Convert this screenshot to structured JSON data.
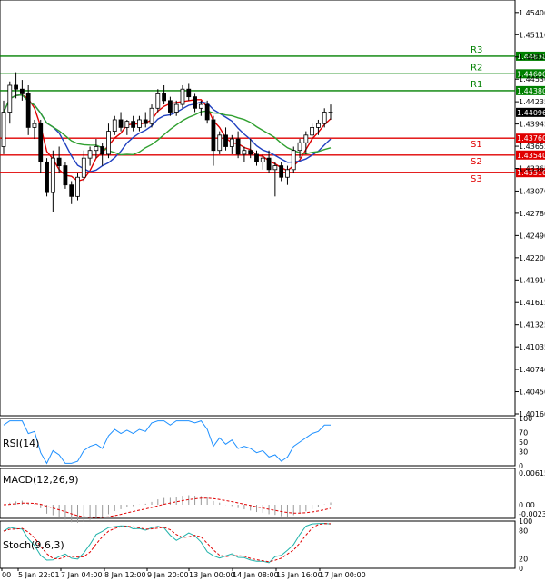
{
  "chart_data": [
    {
      "type": "candlestick",
      "panel": "price",
      "ylim": [
        1.4016,
        1.4554
      ],
      "y_ticks": [
        "1.45400",
        "1.45110",
        "1.44820",
        "1.44530",
        "1.44235",
        "1.43945",
        "1.43655",
        "1.43365",
        "1.43070",
        "1.42780",
        "1.42490",
        "1.42200",
        "1.41910",
        "1.41615",
        "1.41325",
        "1.41035",
        "1.40740",
        "1.40450",
        "1.40160"
      ],
      "x_labels": [
        "00",
        "5 Jan 22:01",
        "7 Jan 04:00",
        "8 Jan 12:00",
        "9 Jan 20:00",
        "13 Jan 00:00",
        "14 Jan 08:00",
        "15 Jan 16:00",
        "17 Jan 00:00"
      ],
      "levels": [
        {
          "name": "R3",
          "value": 1.4483,
          "label": "1.44830",
          "color": "#008000"
        },
        {
          "name": "R2",
          "value": 1.446,
          "label": "1.44600",
          "color": "#008000"
        },
        {
          "name": "R1",
          "value": 1.4438,
          "label": "1.44380",
          "color": "#008000"
        },
        {
          "name": "S1",
          "value": 1.4376,
          "label": "1.43760",
          "color": "#e00000"
        },
        {
          "name": "S2",
          "value": 1.4354,
          "label": "1.43540",
          "color": "#e00000"
        },
        {
          "name": "S3",
          "value": 1.4331,
          "label": "1.43310",
          "color": "#e00000"
        }
      ],
      "current_price": {
        "value": 1.44096,
        "label": "1.44096"
      },
      "candles": [
        [
          1.4365,
          1.4425,
          1.4355,
          1.441
        ],
        [
          1.441,
          1.445,
          1.4395,
          1.4445
        ],
        [
          1.4445,
          1.4462,
          1.4428,
          1.444
        ],
        [
          1.444,
          1.4452,
          1.4425,
          1.4435
        ],
        [
          1.4435,
          1.4445,
          1.438,
          1.439
        ],
        [
          1.439,
          1.44,
          1.4375,
          1.4395
        ],
        [
          1.4395,
          1.44,
          1.433,
          1.4345
        ],
        [
          1.4345,
          1.435,
          1.43,
          1.4305
        ],
        [
          1.4305,
          1.436,
          1.428,
          1.435
        ],
        [
          1.435,
          1.4365,
          1.433,
          1.434
        ],
        [
          1.434,
          1.4345,
          1.431,
          1.4315
        ],
        [
          1.4315,
          1.432,
          1.429,
          1.43
        ],
        [
          1.43,
          1.433,
          1.4295,
          1.4325
        ],
        [
          1.4325,
          1.436,
          1.432,
          1.435
        ],
        [
          1.435,
          1.4365,
          1.434,
          1.436
        ],
        [
          1.436,
          1.4375,
          1.435,
          1.4365
        ],
        [
          1.4365,
          1.437,
          1.434,
          1.4355
        ],
        [
          1.4355,
          1.4395,
          1.435,
          1.4385
        ],
        [
          1.4385,
          1.4405,
          1.438,
          1.44
        ],
        [
          1.44,
          1.441,
          1.4385,
          1.439
        ],
        [
          1.439,
          1.44,
          1.438,
          1.4398
        ],
        [
          1.4398,
          1.4405,
          1.4385,
          1.439
        ],
        [
          1.439,
          1.4405,
          1.4385,
          1.44
        ],
        [
          1.44,
          1.441,
          1.439,
          1.4395
        ],
        [
          1.4395,
          1.442,
          1.439,
          1.4415
        ],
        [
          1.4415,
          1.444,
          1.441,
          1.4435
        ],
        [
          1.4435,
          1.4445,
          1.442,
          1.4425
        ],
        [
          1.4425,
          1.443,
          1.4405,
          1.441
        ],
        [
          1.441,
          1.4425,
          1.4405,
          1.442
        ],
        [
          1.442,
          1.4445,
          1.4415,
          1.444
        ],
        [
          1.444,
          1.4448,
          1.4425,
          1.443
        ],
        [
          1.443,
          1.4435,
          1.441,
          1.4415
        ],
        [
          1.4415,
          1.4425,
          1.4405,
          1.442
        ],
        [
          1.442,
          1.4425,
          1.4395,
          1.44
        ],
        [
          1.44,
          1.4405,
          1.434,
          1.436
        ],
        [
          1.436,
          1.4385,
          1.4355,
          1.438
        ],
        [
          1.438,
          1.439,
          1.436,
          1.4365
        ],
        [
          1.4365,
          1.438,
          1.4355,
          1.4375
        ],
        [
          1.4375,
          1.4385,
          1.435,
          1.4355
        ],
        [
          1.4355,
          1.4365,
          1.4345,
          1.436
        ],
        [
          1.436,
          1.4375,
          1.435,
          1.4355
        ],
        [
          1.4355,
          1.436,
          1.434,
          1.4345
        ],
        [
          1.4345,
          1.4355,
          1.4335,
          1.435
        ],
        [
          1.435,
          1.436,
          1.433,
          1.4335
        ],
        [
          1.4335,
          1.4345,
          1.43,
          1.434
        ],
        [
          1.434,
          1.4345,
          1.432,
          1.4325
        ],
        [
          1.4325,
          1.434,
          1.4315,
          1.4335
        ],
        [
          1.4335,
          1.4365,
          1.433,
          1.436
        ],
        [
          1.436,
          1.4375,
          1.435,
          1.437
        ],
        [
          1.437,
          1.4385,
          1.4355,
          1.438
        ],
        [
          1.438,
          1.4395,
          1.4375,
          1.439
        ],
        [
          1.439,
          1.44,
          1.438,
          1.4395
        ],
        [
          1.4395,
          1.4415,
          1.439,
          1.441
        ],
        [
          1.441,
          1.442,
          1.44,
          1.441
        ]
      ]
    },
    {
      "type": "line",
      "panel": "rsi",
      "title": "RSI(14)",
      "ylim": [
        0,
        100
      ],
      "y_ticks": [
        "100",
        "70",
        "50",
        "30",
        "0"
      ]
    },
    {
      "type": "line",
      "panel": "macd",
      "title": "MACD(12,26,9)",
      "y_ticks": [
        "0.006151",
        "0.00",
        "-0.00231"
      ]
    },
    {
      "type": "line",
      "panel": "stoch",
      "title": "Stoch(9,6,3)",
      "ylim": [
        0,
        100
      ],
      "y_ticks": [
        "100",
        "80",
        "20",
        "0"
      ]
    }
  ]
}
